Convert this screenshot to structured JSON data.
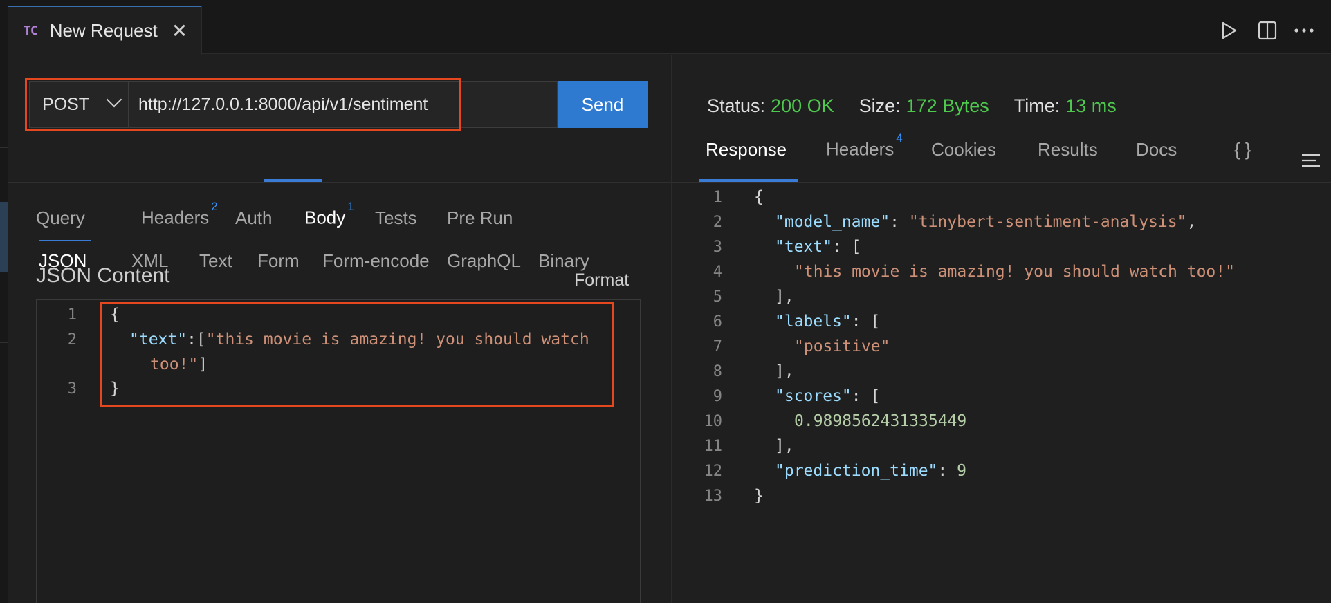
{
  "tab": {
    "icon_text": "TC",
    "title": "New Request"
  },
  "request": {
    "method": "POST",
    "url": "http://127.0.0.1:8000/api/v1/sentiment",
    "send_label": "Send",
    "tabs": [
      {
        "label": "Query",
        "badge": ""
      },
      {
        "label": "Headers",
        "badge": "2"
      },
      {
        "label": "Auth",
        "badge": ""
      },
      {
        "label": "Body",
        "badge": "1"
      },
      {
        "label": "Tests",
        "badge": ""
      },
      {
        "label": "Pre Run",
        "badge": ""
      }
    ],
    "body_types": [
      "JSON",
      "XML",
      "Text",
      "Form",
      "Form-encode",
      "GraphQL",
      "Binary"
    ],
    "content_title": "JSON Content",
    "format_label": "Format",
    "editor_line_numbers": [
      "1",
      "2",
      "3"
    ]
  },
  "response": {
    "status_label": "Status:",
    "status_value": "200 OK",
    "size_label": "Size:",
    "size_value": "172 Bytes",
    "time_label": "Time:",
    "time_value": "13 ms",
    "tabs": [
      {
        "label": "Response",
        "badge": ""
      },
      {
        "label": "Headers",
        "badge": "4"
      },
      {
        "label": "Cookies",
        "badge": ""
      },
      {
        "label": "Results",
        "badge": ""
      },
      {
        "label": "Docs",
        "badge": ""
      }
    ],
    "braces_label": "{ }",
    "line_numbers": [
      "1",
      "2",
      "3",
      "4",
      "5",
      "6",
      "7",
      "8",
      "9",
      "10",
      "11",
      "12",
      "13"
    ],
    "body": {
      "model_name_key": "\"model_name\"",
      "model_name_value": "\"tinybert-sentiment-analysis\"",
      "text_key": "\"text\"",
      "text_value": "\"this movie is amazing! you should watch too!\"",
      "labels_key": "\"labels\"",
      "labels_value": "\"positive\"",
      "scores_key": "\"scores\"",
      "scores_value": "0.9898562431335449",
      "prediction_time_key": "\"prediction_time\"",
      "prediction_time_value": "9"
    }
  },
  "request_body": {
    "text_key": "\"text\"",
    "text_value_part1": "\"this movie is amazing! you should watch",
    "text_value_part2": "too!\""
  },
  "colors": {
    "accent": "#2e7ad1",
    "status_ok": "#4ec94e",
    "highlight": "#e5471e"
  }
}
